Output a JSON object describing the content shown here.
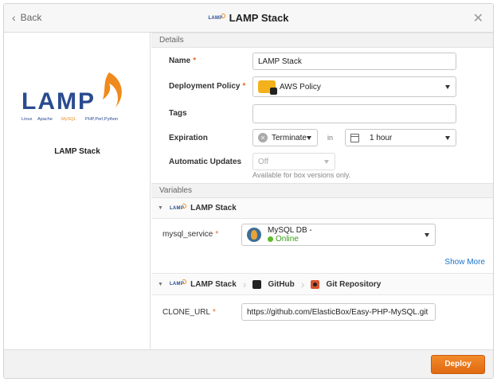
{
  "header": {
    "back_label": "Back",
    "title": "LAMP Stack",
    "mini_logo_text": "LAMP",
    "close_glyph": "✕"
  },
  "sidebar": {
    "logo_text": "LAMP",
    "logo_subtitle": "Linux Apache MySQL PHP,Perl,Python",
    "logo_sub_linux": "Linux",
    "logo_sub_apache": "Apache",
    "logo_sub_mysql": "MySQL",
    "logo_sub_php": "PHP,Perl,Python",
    "name": "LAMP Stack"
  },
  "details": {
    "section_title": "Details",
    "name_label": "Name",
    "name_value": "LAMP Stack",
    "policy_label": "Deployment Policy",
    "policy_value": "AWS Policy",
    "tags_label": "Tags",
    "tags_value": "",
    "expiration_label": "Expiration",
    "expiration_action": "Terminate",
    "in_label": "in",
    "expiration_time": "1 hour",
    "updates_label": "Automatic Updates",
    "updates_value": "Off",
    "updates_note": "Available for box versions only."
  },
  "variables": {
    "section_title": "Variables",
    "group1_title": "LAMP Stack",
    "mysql_label": "mysql_service",
    "mysql_name": "MySQL DB -",
    "mysql_status": "Online",
    "show_more": "Show More",
    "breadcrumb": [
      "LAMP Stack",
      "GitHub",
      "Git Repository"
    ],
    "clone_label": "CLONE_URL",
    "clone_value": "https://github.com/ElasticBox/Easy-PHP-MySQL.git"
  },
  "footer": {
    "deploy_label": "Deploy"
  },
  "colors": {
    "accent": "#e8751a",
    "brand_blue": "#2a4b8f",
    "online": "#5cbb2a",
    "link": "#1a73c9"
  }
}
